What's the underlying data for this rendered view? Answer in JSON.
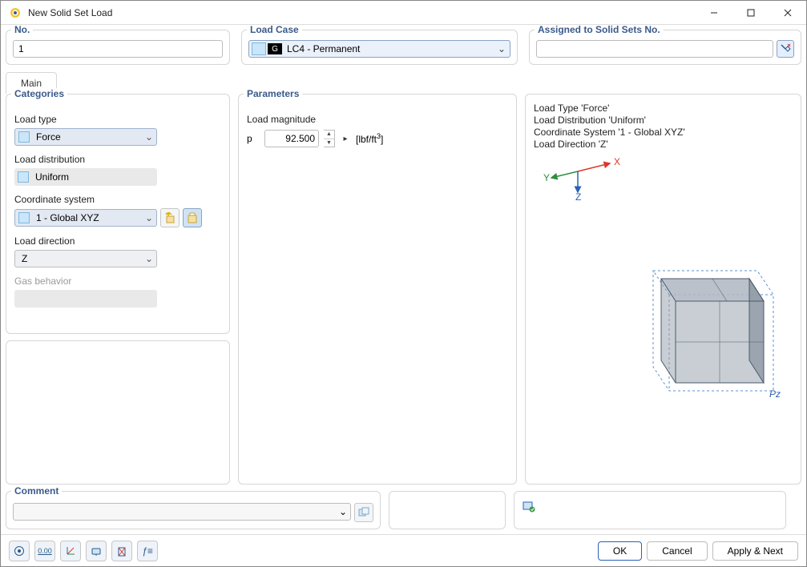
{
  "window": {
    "title": "New Solid Set Load"
  },
  "top": {
    "no": {
      "legend": "No.",
      "value": "1"
    },
    "loadCase": {
      "legend": "Load Case",
      "badge": "G",
      "text": "LC4 - Permanent"
    },
    "assigned": {
      "legend": "Assigned to Solid Sets No."
    }
  },
  "tabs": {
    "main": "Main"
  },
  "categories": {
    "legend": "Categories",
    "loadType": {
      "label": "Load type",
      "value": "Force"
    },
    "loadDist": {
      "label": "Load distribution",
      "value": "Uniform"
    },
    "coordSys": {
      "label": "Coordinate system",
      "value": "1 - Global XYZ"
    },
    "loadDir": {
      "label": "Load direction",
      "value": "Z"
    },
    "gas": {
      "label": "Gas behavior"
    }
  },
  "parameters": {
    "legend": "Parameters",
    "magnitude": {
      "label": "Load magnitude",
      "symbol": "p",
      "value": "92.500",
      "unit_html": "[lbf/ft³]"
    }
  },
  "preview": {
    "lines": [
      "Load Type 'Force'",
      "Load Distribution 'Uniform'",
      "Coordinate System '1 - Global XYZ'",
      "Load Direction 'Z'"
    ],
    "axes": {
      "x": "X",
      "y": "Y",
      "z": "Z"
    },
    "pz": "Pz"
  },
  "comment": {
    "legend": "Comment"
  },
  "buttons": {
    "ok": "OK",
    "cancel": "Cancel",
    "applyNext": "Apply & Next"
  }
}
